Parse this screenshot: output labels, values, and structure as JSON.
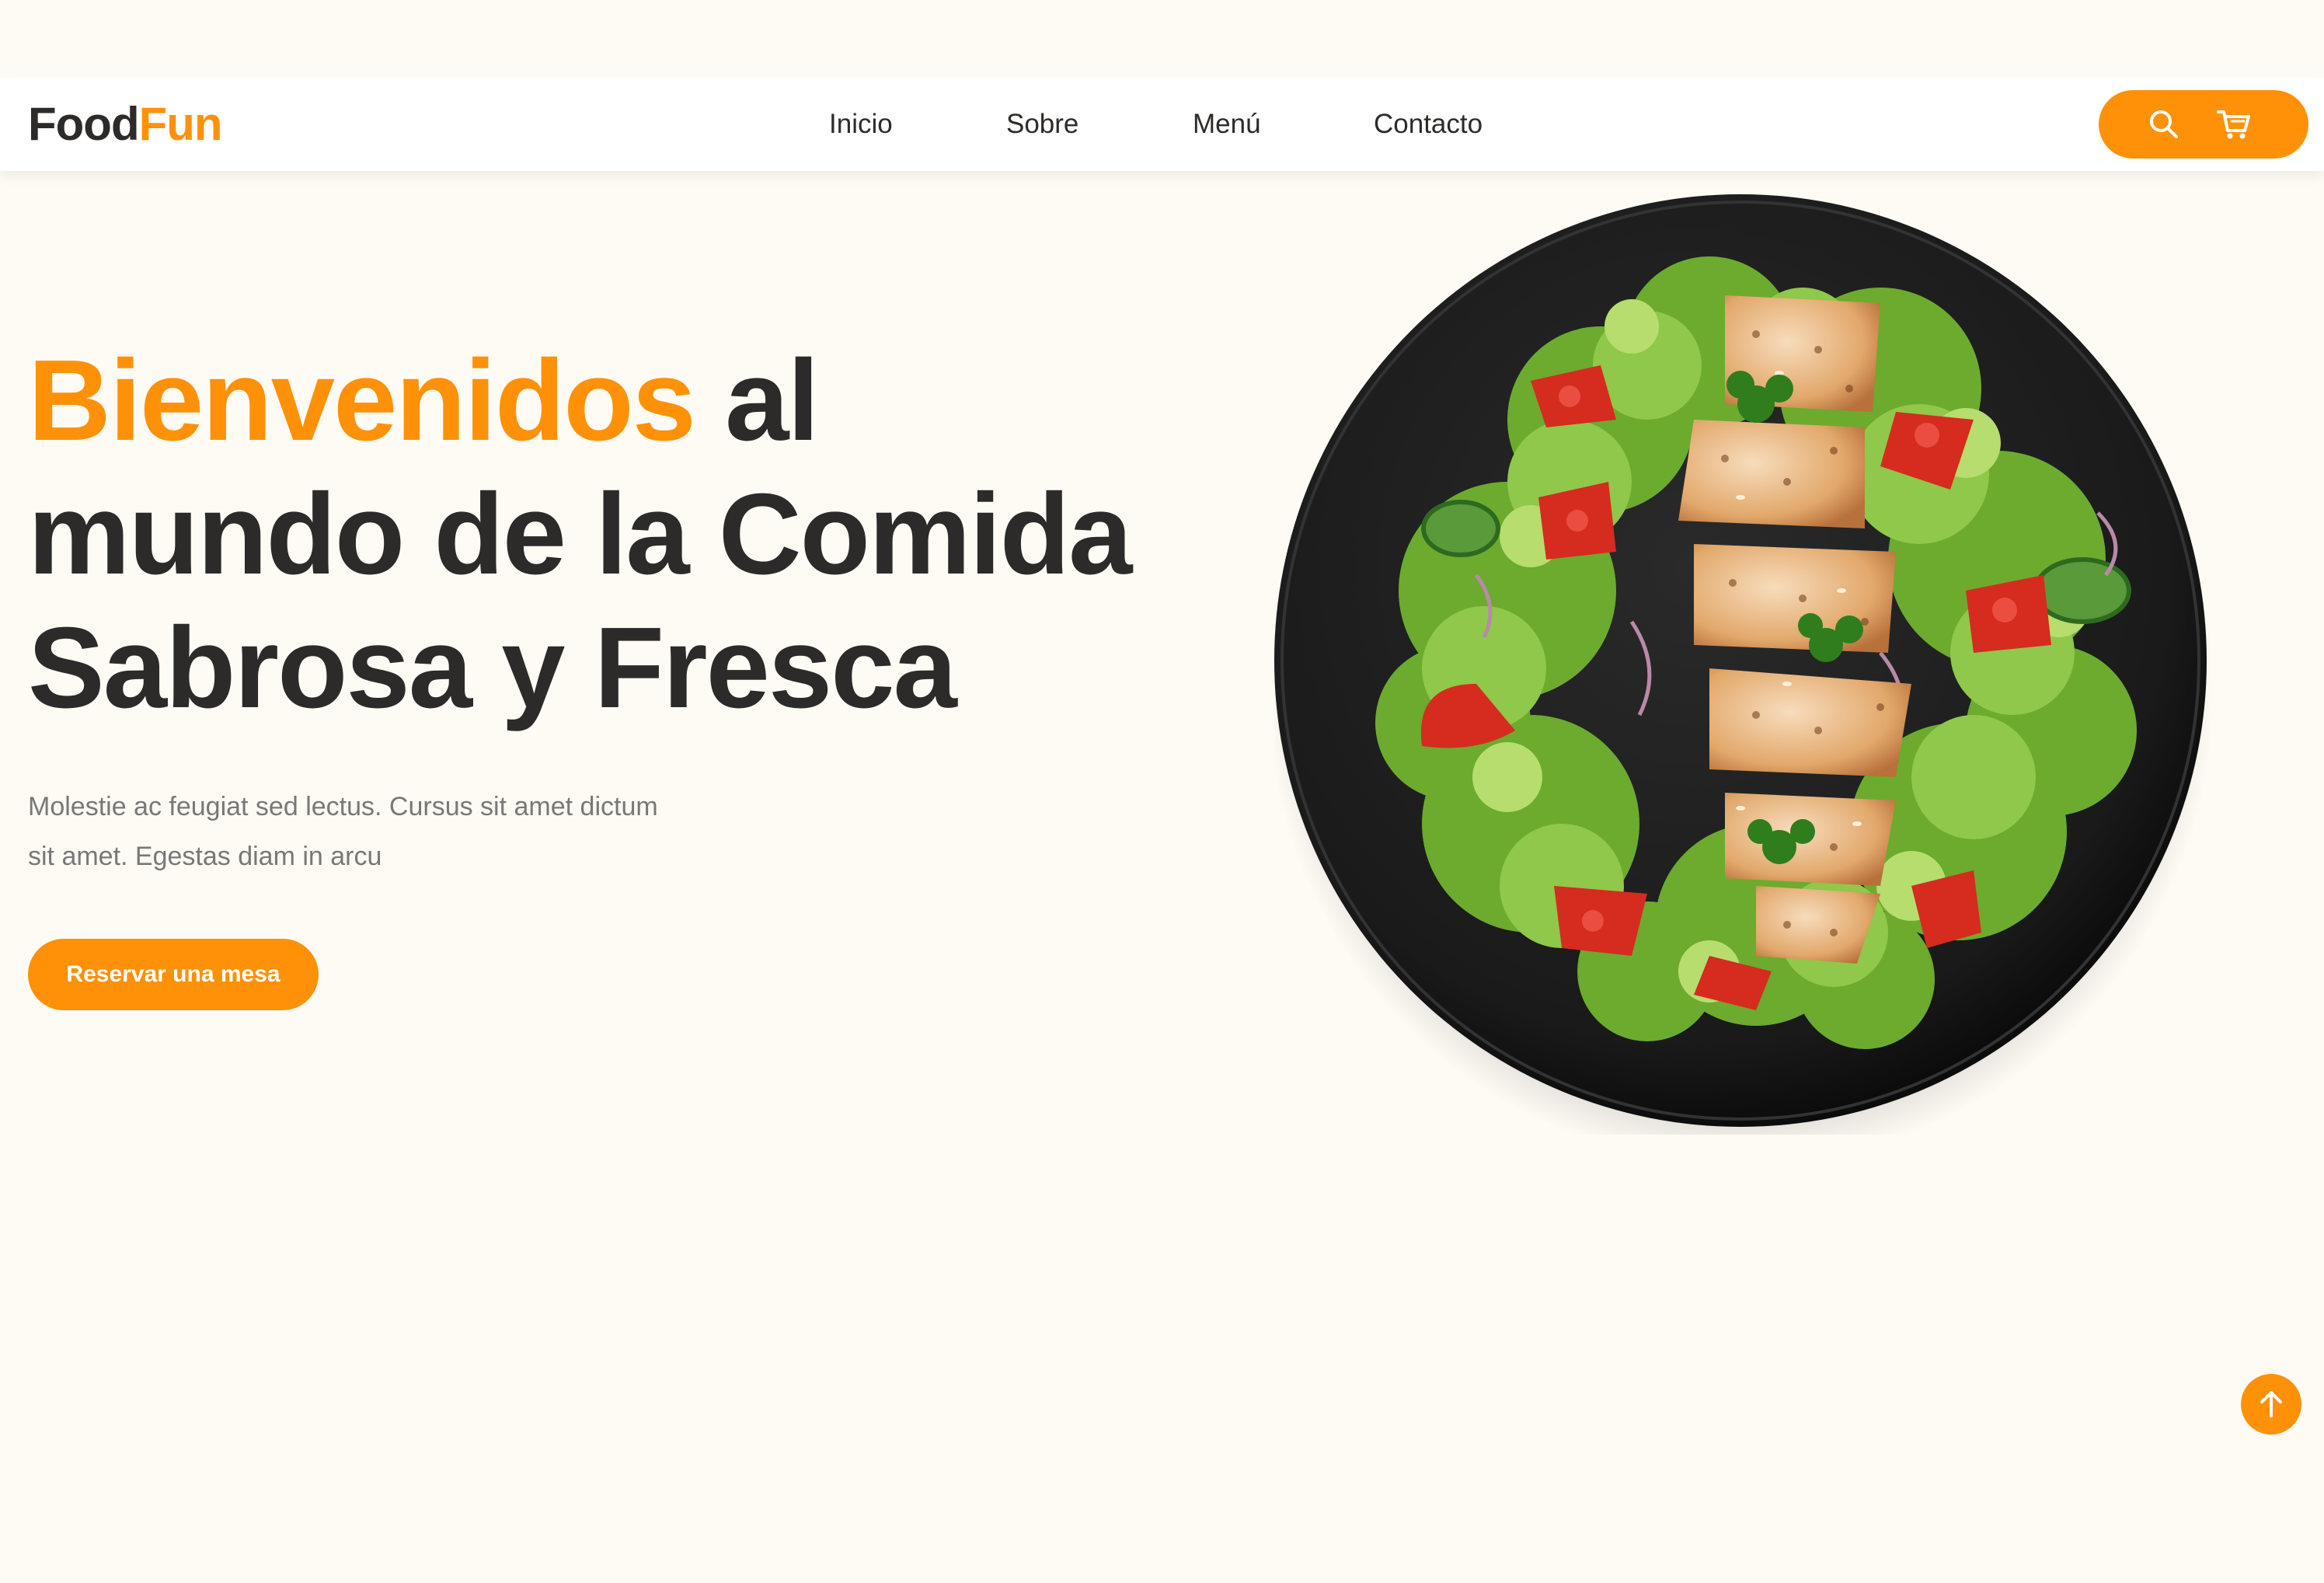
{
  "brand": {
    "part1": "Food",
    "part2": "Fun",
    "colors": {
      "accent": "#ff9109",
      "dark": "#2d2b29",
      "background": "#fefbf5"
    }
  },
  "nav": {
    "items": [
      "Inicio",
      "Sobre",
      "Menú",
      "Contacto"
    ]
  },
  "header_actions": {
    "search_icon": "search-icon",
    "cart_icon": "cart-icon"
  },
  "hero": {
    "title_highlight": "Bienvenidos",
    "title_rest_line1": " al",
    "title_line2": "mundo de la Comida",
    "title_line3": "Sabrosa y Fresca",
    "description": "Molestie ac feugiat sed lectus. Cursus sit amet dictum sit amet. Egestas diam in arcu",
    "cta_label": "Reservar una mesa"
  },
  "images": {
    "hero_plate": "salad-plate-image"
  },
  "scroll_top_icon": "arrow-up-icon"
}
